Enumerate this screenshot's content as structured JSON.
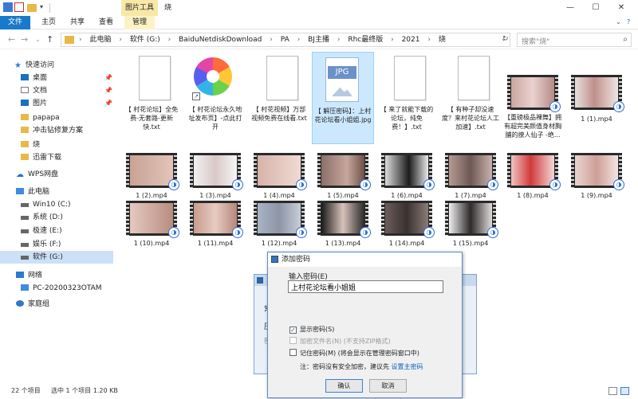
{
  "window": {
    "title": "烧",
    "picture_tools": "图片工具",
    "controls": [
      "—",
      "☐",
      "✕"
    ]
  },
  "ribbon": {
    "tabs": [
      "文件",
      "主页",
      "共享",
      "查看",
      "管理"
    ]
  },
  "address": {
    "crumbs": [
      "此电脑",
      "软件 (G:)",
      "BaiduNetdiskDownload",
      "PA",
      "BJ主播",
      "Rhc最终版",
      "2021",
      "烧"
    ],
    "search_placeholder": "搜索\"烧\""
  },
  "nav": {
    "quick_access": "快速访问",
    "items": [
      {
        "label": "桌面",
        "icon": "desktop-icon",
        "pinned": true
      },
      {
        "label": "文档",
        "icon": "documents-icon",
        "pinned": true
      },
      {
        "label": "图片",
        "icon": "pictures-icon",
        "pinned": true
      },
      {
        "label": "papapa",
        "icon": "folder-icon"
      },
      {
        "label": "冲击钻修复方案",
        "icon": "folder-icon"
      },
      {
        "label": "烧",
        "icon": "folder-icon"
      },
      {
        "label": "迅雷下载",
        "icon": "folder-icon"
      }
    ],
    "wps": "WPS网盘",
    "this_pc": "此电脑",
    "drives": [
      "Win10 (C:)",
      "系统 (D:)",
      "极速 (E:)",
      "娱乐 (F:)",
      "软件 (G:)"
    ],
    "network": "网络",
    "network_pc": "PC-20200323OTAM",
    "homegroup": "家庭组"
  },
  "files": {
    "docs": [
      {
        "name": "【 村花论坛】全免费-无套路-更新快.txt",
        "type": "txt"
      },
      {
        "name": "【 村花论坛永久地址发布页】-点此打开",
        "type": "shortcut"
      },
      {
        "name": "【 村花视频】万部视频免费在线看.txt",
        "type": "txt"
      },
      {
        "name": "【 解压密码】：上村花论坛看小姐姐.jpg",
        "type": "jpg",
        "badge": "JPG"
      },
      {
        "name": "【 来了就能下载的论坛，纯免费！】.txt",
        "type": "txt"
      },
      {
        "name": "【 有种子却没速度？来村花论坛人工加速】.txt",
        "type": "txt"
      },
      {
        "name": "【重磅极品裸舞】拥有超完美颜值身材胸脯的撩人仙子 -绝...",
        "type": "video"
      },
      {
        "name": "1 (1).mp4",
        "type": "video"
      }
    ],
    "videos": [
      "1 (2).mp4",
      "1 (3).mp4",
      "1 (4).mp4",
      "1 (5).mp4",
      "1 (6).mp4",
      "1 (7).mp4",
      "1 (8).mp4",
      "1 (9).mp4",
      "1 (10).mp4",
      "1 (11).mp4",
      "1 (12).mp4",
      "1 (13).mp4",
      "1 (14).mp4",
      "1 (15).mp4"
    ]
  },
  "status": {
    "count": "22 个项目",
    "selection": "选中 1 个项目  1.20 KB"
  },
  "bg_dialog": {
    "fields": [
      "常",
      "压",
      "密"
    ]
  },
  "dialog": {
    "title": "添加密码",
    "input_label": "输入密码(E)",
    "input_value": "上村花论坛看小姐姐",
    "show_password": "显示密码(S)",
    "show_password_checked": true,
    "encrypt_names": "加密文件名(N) (不支持ZIP格式)",
    "remember": "记住密码(M) (将会显示在管理密码窗口中)",
    "note": "注：密码没有安全加密，建议先",
    "note_link": "设置主密码",
    "ok": "确认",
    "cancel": "取消"
  },
  "colors": {
    "accent": "#1979ca",
    "selection": "#cce0f7"
  }
}
